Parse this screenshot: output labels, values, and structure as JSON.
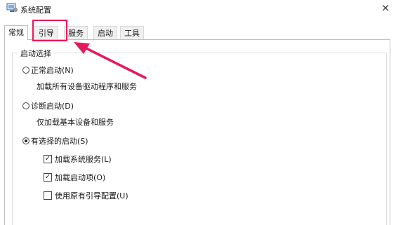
{
  "window": {
    "title": "系统配置",
    "close_glyph": "×",
    "icon": "system-config-icon"
  },
  "tabs": [
    {
      "label": "常规",
      "active": true
    },
    {
      "label": "引导",
      "active": false
    },
    {
      "label": "服务",
      "active": false
    },
    {
      "label": "启动",
      "active": false
    },
    {
      "label": "工具",
      "active": false
    }
  ],
  "startup_group": {
    "legend": "启动选择",
    "options": [
      {
        "label": "正常启动(N)",
        "description": "加载所有设备驱动程序和服务",
        "selected": false
      },
      {
        "label": "诊断启动(D)",
        "description": "仅加载基本设备和服务",
        "selected": false
      },
      {
        "label": "有选择的启动(S)",
        "selected": true
      }
    ],
    "selective_items": [
      {
        "label": "加载系统服务(L)",
        "checked": true
      },
      {
        "label": "加载启动项(O)",
        "checked": true
      },
      {
        "label": "使用原有引导配置(U)",
        "checked": false
      }
    ]
  },
  "annotation": {
    "highlight_color": "#e6195b",
    "highlighted_tab": "引导"
  },
  "colors": {
    "window_bg": "#ffffff",
    "border": "#bfbfbf",
    "annotation": "#e6195b"
  }
}
